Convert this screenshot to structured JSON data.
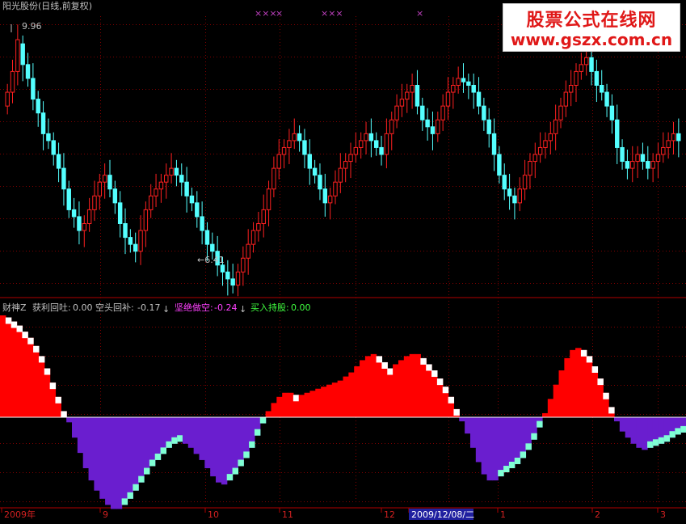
{
  "header": {
    "title": "阳光股份(日线,前复权)",
    "high_label": "9.96",
    "low_label": "←6.41",
    "signal_marks": [
      "×××",
      "×",
      "×××",
      "×"
    ]
  },
  "indicator": {
    "name": "财神Z",
    "items": [
      {
        "label": "获利回吐:",
        "value": "0.00",
        "arrow": ""
      },
      {
        "label": "空头回补:",
        "value": "-0.17",
        "arrow": "↓"
      },
      {
        "label": "坚绝做空:",
        "value": "-0.24",
        "arrow": "↓"
      },
      {
        "label": "买入持股:",
        "value": "0.00",
        "arrow": ""
      }
    ]
  },
  "watermark": {
    "line1": "股票公式在线网",
    "line2": "www.gszx.com.cn"
  },
  "colors": {
    "up": "#ff2020",
    "down": "#54ffff",
    "indicator_red": "#ff0000",
    "indicator_purple": "#6a1ecf",
    "indicator_white": "#ffffff",
    "indicator_cyan": "#7fffd4",
    "grid": "#800000",
    "axis": "#b00000"
  },
  "chart_data": [
    {
      "type": "candlestick",
      "title": "阳光股份(日线,前复权)",
      "price_range": [
        6.3,
        10.3
      ],
      "marked_high": 9.96,
      "marked_low": 6.41,
      "x_ticks": [
        "2009年",
        "9",
        "10",
        "11",
        "12",
        "2009/12/08/二",
        "1",
        "2",
        "3"
      ],
      "closes": [
        9.2,
        9.5,
        9.96,
        9.6,
        9.4,
        9.1,
        8.9,
        8.6,
        8.5,
        8.3,
        8.1,
        7.8,
        7.5,
        7.4,
        7.2,
        7.3,
        7.5,
        7.7,
        7.9,
        8.0,
        7.8,
        7.6,
        7.3,
        7.1,
        7.0,
        6.9,
        7.2,
        7.5,
        7.7,
        7.8,
        7.9,
        8.0,
        8.1,
        8.0,
        7.9,
        7.7,
        7.6,
        7.4,
        7.2,
        7.0,
        6.9,
        6.7,
        6.6,
        6.5,
        6.41,
        6.6,
        6.8,
        7.0,
        7.2,
        7.3,
        7.5,
        7.8,
        8.1,
        8.3,
        8.4,
        8.5,
        8.6,
        8.5,
        8.3,
        8.1,
        8.0,
        7.8,
        7.6,
        7.7,
        7.9,
        8.1,
        8.2,
        8.3,
        8.4,
        8.5,
        8.6,
        8.5,
        8.4,
        8.3,
        8.6,
        8.8,
        9.0,
        9.1,
        9.2,
        9.3,
        9.0,
        8.8,
        8.7,
        8.6,
        8.8,
        9.0,
        9.2,
        9.3,
        9.4,
        9.35,
        9.3,
        9.2,
        9.0,
        8.8,
        8.6,
        8.3,
        8.0,
        7.8,
        7.7,
        7.6,
        7.8,
        8.0,
        8.2,
        8.3,
        8.4,
        8.5,
        8.6,
        8.8,
        9.0,
        9.2,
        9.3,
        9.5,
        9.6,
        9.7,
        9.5,
        9.3,
        9.2,
        9.0,
        8.8,
        8.4,
        8.2,
        8.1,
        8.2,
        8.3,
        8.2,
        8.1,
        8.2,
        8.3,
        8.4,
        8.5,
        8.6,
        8.5
      ],
      "opens": [
        9.0,
        9.2,
        9.5,
        9.9,
        9.6,
        9.4,
        9.1,
        8.9,
        8.6,
        8.5,
        8.3,
        8.1,
        7.8,
        7.5,
        7.4,
        7.2,
        7.3,
        7.5,
        7.7,
        7.9,
        8.0,
        7.8,
        7.6,
        7.3,
        7.1,
        7.0,
        6.9,
        7.2,
        7.5,
        7.7,
        7.8,
        7.9,
        8.0,
        8.1,
        8.0,
        7.9,
        7.7,
        7.6,
        7.4,
        7.2,
        7.0,
        6.9,
        6.7,
        6.6,
        6.5,
        6.41,
        6.6,
        6.8,
        7.0,
        7.2,
        7.3,
        7.5,
        7.8,
        8.1,
        8.3,
        8.4,
        8.5,
        8.6,
        8.5,
        8.3,
        8.1,
        8.0,
        7.8,
        7.6,
        7.7,
        7.9,
        8.1,
        8.2,
        8.3,
        8.4,
        8.5,
        8.6,
        8.5,
        8.4,
        8.3,
        8.6,
        8.8,
        9.0,
        9.1,
        9.2,
        9.3,
        9.0,
        8.8,
        8.7,
        8.6,
        8.8,
        9.0,
        9.2,
        9.3,
        9.4,
        9.35,
        9.3,
        9.2,
        9.0,
        8.8,
        8.6,
        8.3,
        8.0,
        7.8,
        7.7,
        7.6,
        7.8,
        8.0,
        8.2,
        8.3,
        8.4,
        8.5,
        8.6,
        8.8,
        9.0,
        9.2,
        9.3,
        9.5,
        9.6,
        9.7,
        9.5,
        9.3,
        9.2,
        9.0,
        8.8,
        8.4,
        8.2,
        8.1,
        8.2,
        8.3,
        8.2,
        8.1,
        8.2,
        8.3,
        8.4,
        8.5,
        8.6
      ]
    },
    {
      "type": "area",
      "title": "财神Z",
      "y_range": [
        -1.0,
        1.0
      ],
      "values": [
        1.0,
        0.98,
        0.94,
        0.9,
        0.84,
        0.78,
        0.7,
        0.6,
        0.48,
        0.34,
        0.2,
        0.06,
        -0.05,
        -0.2,
        -0.35,
        -0.5,
        -0.62,
        -0.72,
        -0.8,
        -0.86,
        -0.9,
        -0.9,
        -0.86,
        -0.8,
        -0.72,
        -0.64,
        -0.56,
        -0.48,
        -0.42,
        -0.36,
        -0.3,
        -0.26,
        -0.24,
        -0.26,
        -0.3,
        -0.36,
        -0.42,
        -0.5,
        -0.58,
        -0.64,
        -0.66,
        -0.62,
        -0.56,
        -0.48,
        -0.4,
        -0.3,
        -0.18,
        -0.06,
        0.06,
        0.14,
        0.2,
        0.24,
        0.24,
        0.22,
        0.22,
        0.24,
        0.26,
        0.28,
        0.3,
        0.32,
        0.34,
        0.36,
        0.4,
        0.44,
        0.5,
        0.56,
        0.6,
        0.62,
        0.6,
        0.54,
        0.48,
        0.52,
        0.56,
        0.6,
        0.62,
        0.62,
        0.58,
        0.52,
        0.46,
        0.38,
        0.3,
        0.2,
        0.08,
        -0.04,
        -0.16,
        -0.3,
        -0.44,
        -0.56,
        -0.62,
        -0.62,
        -0.58,
        -0.54,
        -0.5,
        -0.46,
        -0.4,
        -0.32,
        -0.22,
        -0.1,
        0.04,
        0.18,
        0.32,
        0.46,
        0.58,
        0.66,
        0.68,
        0.66,
        0.6,
        0.5,
        0.38,
        0.24,
        0.1,
        -0.04,
        -0.14,
        -0.2,
        -0.26,
        -0.3,
        -0.32,
        -0.3,
        -0.28,
        -0.26,
        -0.24,
        -0.2,
        -0.17,
        -0.15
      ]
    }
  ]
}
